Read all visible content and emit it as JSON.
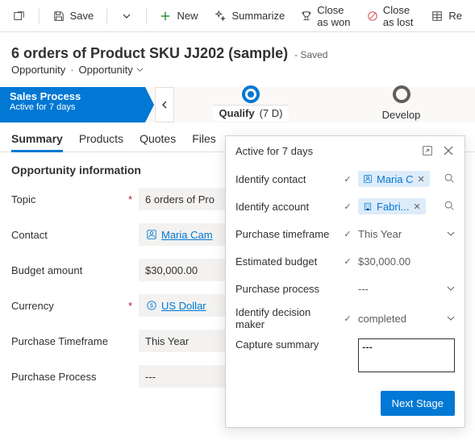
{
  "toolbar": {
    "save": "Save",
    "new": "New",
    "summarize": "Summarize",
    "closeWon": "Close as won",
    "closeLost": "Close as lost",
    "recalc": "Re"
  },
  "header": {
    "title": "6 orders of Product SKU JJ202 (sample)",
    "savedLabel": "- Saved",
    "entity": "Opportunity",
    "formName": "Opportunity"
  },
  "process": {
    "name": "Sales Process",
    "subtitle": "Active for 7 days",
    "stages": {
      "qualify": {
        "label": "Qualify",
        "duration": "(7 D)"
      },
      "develop": {
        "label": "Develop"
      }
    }
  },
  "tabs": [
    "Summary",
    "Products",
    "Quotes",
    "Files"
  ],
  "section": {
    "title": "Opportunity information",
    "rows": {
      "topic": {
        "label": "Topic",
        "value": "6 orders of Pro",
        "required": true
      },
      "contact": {
        "label": "Contact",
        "value": "Maria Cam"
      },
      "budget": {
        "label": "Budget amount",
        "value": "$30,000.00"
      },
      "currency": {
        "label": "Currency",
        "value": "US Dollar",
        "required": true
      },
      "timeframe": {
        "label": "Purchase Timeframe",
        "value": "This Year"
      },
      "process": {
        "label": "Purchase Process",
        "value": "---"
      }
    }
  },
  "flyout": {
    "title": "Active for 7 days",
    "rows": {
      "contact": {
        "label": "Identify contact",
        "value": "Maria C",
        "checked": true,
        "type": "lookup"
      },
      "account": {
        "label": "Identify account",
        "value": "Fabri...",
        "checked": true,
        "type": "lookup"
      },
      "timeframe": {
        "label": "Purchase timeframe",
        "value": "This Year",
        "checked": true,
        "type": "select"
      },
      "budget": {
        "label": "Estimated budget",
        "value": "$30,000.00",
        "checked": true,
        "type": "text"
      },
      "process": {
        "label": "Purchase process",
        "value": "---",
        "type": "select"
      },
      "decision": {
        "label": "Identify decision maker",
        "value": "completed",
        "checked": true,
        "type": "select"
      },
      "summary": {
        "label": "Capture summary",
        "value": "---",
        "type": "textarea"
      }
    },
    "nextStage": "Next Stage"
  }
}
